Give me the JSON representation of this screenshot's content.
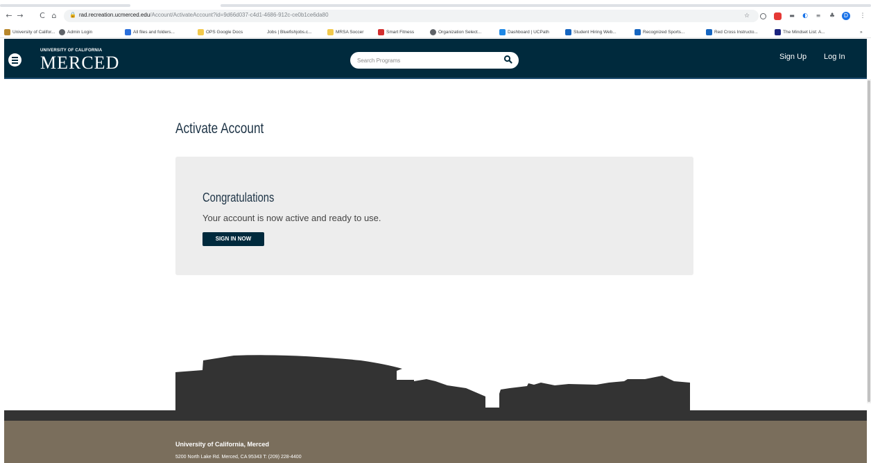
{
  "browser": {
    "url_host": "rad.recreation.ucmerced.edu",
    "url_path": "/Account/ActivateAccount?id=9d66d037-c4d1-4686-912c-ce0b1ce6da80",
    "nav": {
      "back": "←",
      "forward": "→",
      "reload": "C",
      "home": "⌂"
    },
    "bookmarks": [
      {
        "label": "University of Califor...",
        "icon": "uc-icon",
        "color": "#b8872c"
      },
      {
        "label": "Admin Login",
        "icon": "globe-icon",
        "color": "#5f6368"
      },
      {
        "label": "All files and folders...",
        "icon": "box-icon",
        "color": "#2a6fdb"
      },
      {
        "label": "OPS Google Docs",
        "icon": "folder-icon",
        "color": "#f2c94c"
      },
      {
        "label": "Jobs | Bluefishjobs.c...",
        "icon": "none",
        "color": "#ffffff"
      },
      {
        "label": "MRSA Soccer",
        "icon": "folder-icon",
        "color": "#f2c94c"
      },
      {
        "label": "Smart Fitness",
        "icon": "fitness-icon",
        "color": "#d32f2f"
      },
      {
        "label": "Organization Select...",
        "icon": "globe-icon",
        "color": "#5f6368"
      },
      {
        "label": "Dashboard | UCPath",
        "icon": "ucpath-icon",
        "color": "#1e88e5"
      },
      {
        "label": "Student Hiring Web...",
        "icon": "hiring-icon",
        "color": "#1565c0"
      },
      {
        "label": "Recognized Sports...",
        "icon": "m-icon",
        "color": "#1565c0"
      },
      {
        "label": "Red Cross Instructo...",
        "icon": "redcross-icon",
        "color": "#1565c0"
      },
      {
        "label": "The Mindset List: A...",
        "icon": "book-icon",
        "color": "#1a237e"
      }
    ],
    "more_bookmarks": "»",
    "profile_initial": "D"
  },
  "header": {
    "logo_small": "UNIVERSITY OF CALIFORNIA",
    "logo_big": "MERCED",
    "search_placeholder": "Search Programs",
    "sign_up": "Sign Up",
    "log_in": "Log In"
  },
  "main": {
    "title": "Activate Account",
    "panel_heading": "Congratulations",
    "panel_text": "Your account is now active and ready to use.",
    "button_label": "SIGN IN NOW"
  },
  "footer": {
    "name": "University of California, Merced",
    "address": "5200 North Lake Rd. Merced, CA 95343 T: (209) 228-4400"
  },
  "colors": {
    "header_bg": "#002a3d",
    "panel_bg": "#ededed",
    "footer_bg": "#7a6e5c",
    "skyline": "#333333"
  }
}
